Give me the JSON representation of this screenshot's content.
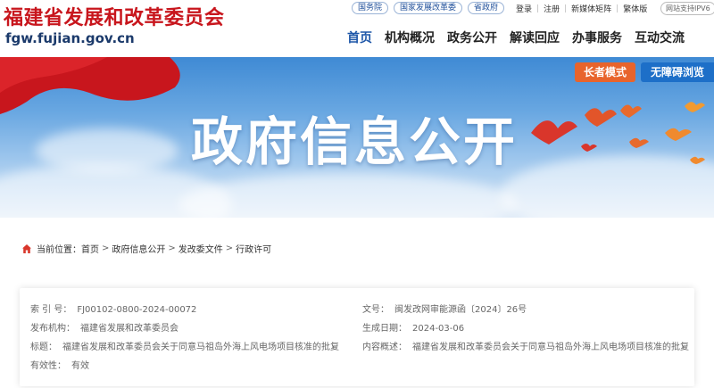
{
  "header": {
    "site_title": "福建省发展和改革委员会",
    "site_url": "fgw.fujian.gov.cn",
    "ext_links": [
      "国务院",
      "国家发展改革委",
      "省政府"
    ],
    "util_links": [
      "登录",
      "注册",
      "新媒体矩阵",
      "繁体版"
    ],
    "ipv6": "网站支持IPV6"
  },
  "nav": {
    "items": [
      "首页",
      "机构概况",
      "政务公开",
      "解读回应",
      "办事服务",
      "互动交流"
    ],
    "active": "首页"
  },
  "banner": {
    "title": "政府信息公开",
    "elder_mode": "长者模式",
    "accessible": "无障碍浏览"
  },
  "breadcrumb": {
    "prefix": "当前位置：",
    "items": [
      "首页",
      "政府信息公开",
      "发改委文件",
      "行政许可"
    ]
  },
  "info": {
    "index_label": "索 引 号：",
    "index_value": "FJ00102-0800-2024-00072",
    "doc_label": "文号：",
    "doc_value": "闽发改网审能源函〔2024〕26号",
    "issuer_label": "发布机构：",
    "issuer_value": "福建省发展和改革委员会",
    "date_label": "生成日期：",
    "date_value": "2024-03-06",
    "title_label": "标题：",
    "title_value": "福建省发展和改革委员会关于同意马祖岛外海上风电场项目核准的批复",
    "summary_label": "内容概述：",
    "summary_value": "福建省发展和改革委员会关于同意马祖岛外海上风电场项目核准的批复",
    "validity_label": "有效性：",
    "validity_value": "有效"
  },
  "colors": {
    "title_red": "#c8161d",
    "nav_active": "#1d56a8",
    "elder_orange": "#e8642c",
    "access_blue": "#1d6fc8"
  }
}
